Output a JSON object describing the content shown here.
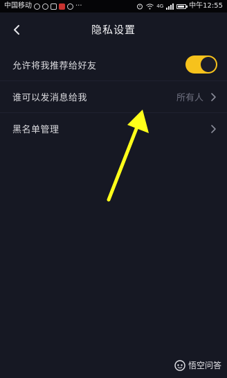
{
  "status_bar": {
    "carrier": "中国移动",
    "more": "···",
    "network": "4G",
    "time": "中午12:55"
  },
  "header": {
    "title": "隐私设置",
    "back_icon": "chevron-left-icon"
  },
  "settings": {
    "items": [
      {
        "label": "允许将我推荐给好友",
        "control": "toggle",
        "enabled": true
      },
      {
        "label": "谁可以发消息给我",
        "value": "所有人",
        "control": "chevron"
      },
      {
        "label": "黑名单管理",
        "control": "chevron"
      }
    ]
  },
  "colors": {
    "background": "#161823",
    "toggle_on": "#f6c21c",
    "annotation_arrow": "#ffff1a"
  },
  "watermark": {
    "text": "悟空问答"
  }
}
